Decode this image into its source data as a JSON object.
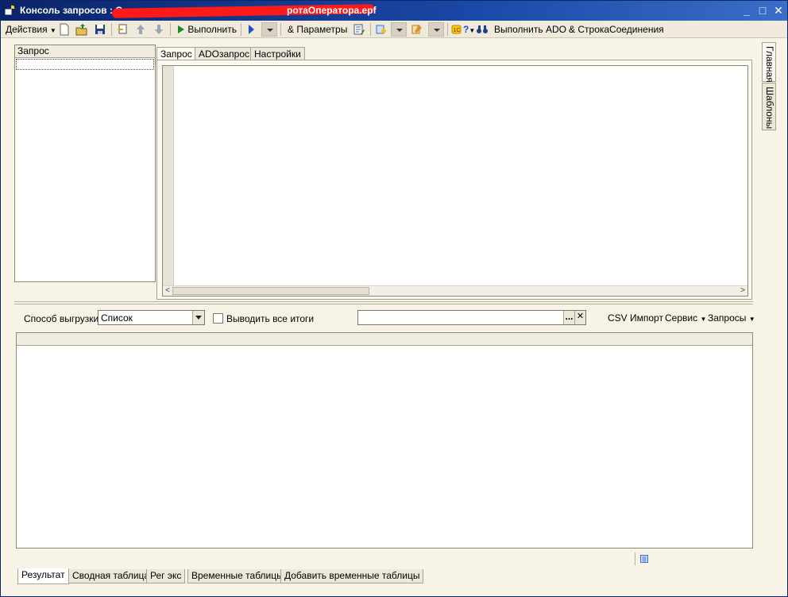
{
  "window": {
    "title": "Консоль запросов : С",
    "title_suffix": "ротаОператора.epf",
    "minimize": "_",
    "maximize": "□",
    "close": "✕"
  },
  "toolbar": {
    "actions_label": "Действия",
    "run_label": "Выполнить",
    "params_label": "Параметры",
    "run_ado_label": "Выполнить ADO",
    "conn_string_label": "СтрокаСоединения"
  },
  "query_list": {
    "header": "Запрос"
  },
  "editor_tabs": [
    "Запрос",
    "ADOзапрос",
    "Настройки"
  ],
  "side_tabs": [
    "Главная",
    "Шаблоны"
  ],
  "controls": {
    "export_mode_label": "Способ выгрузки:",
    "export_mode_value": "Список",
    "show_totals_label": "Выводить все итоги",
    "search_value": "",
    "search_dots": "...",
    "search_clear": "✕",
    "csv_import": "CSV Импорт",
    "service_menu": "Сервис",
    "queries_menu": "Запросы"
  },
  "bottom_tabs": [
    "Результат",
    "Сводная таблица",
    "Рег экс",
    "Временные таблицы",
    "Добавить временные таблицы"
  ],
  "colors": {
    "titlebar": "#0a246a",
    "panel": "#f7f3e6",
    "redaction": "#ff1a1a"
  }
}
